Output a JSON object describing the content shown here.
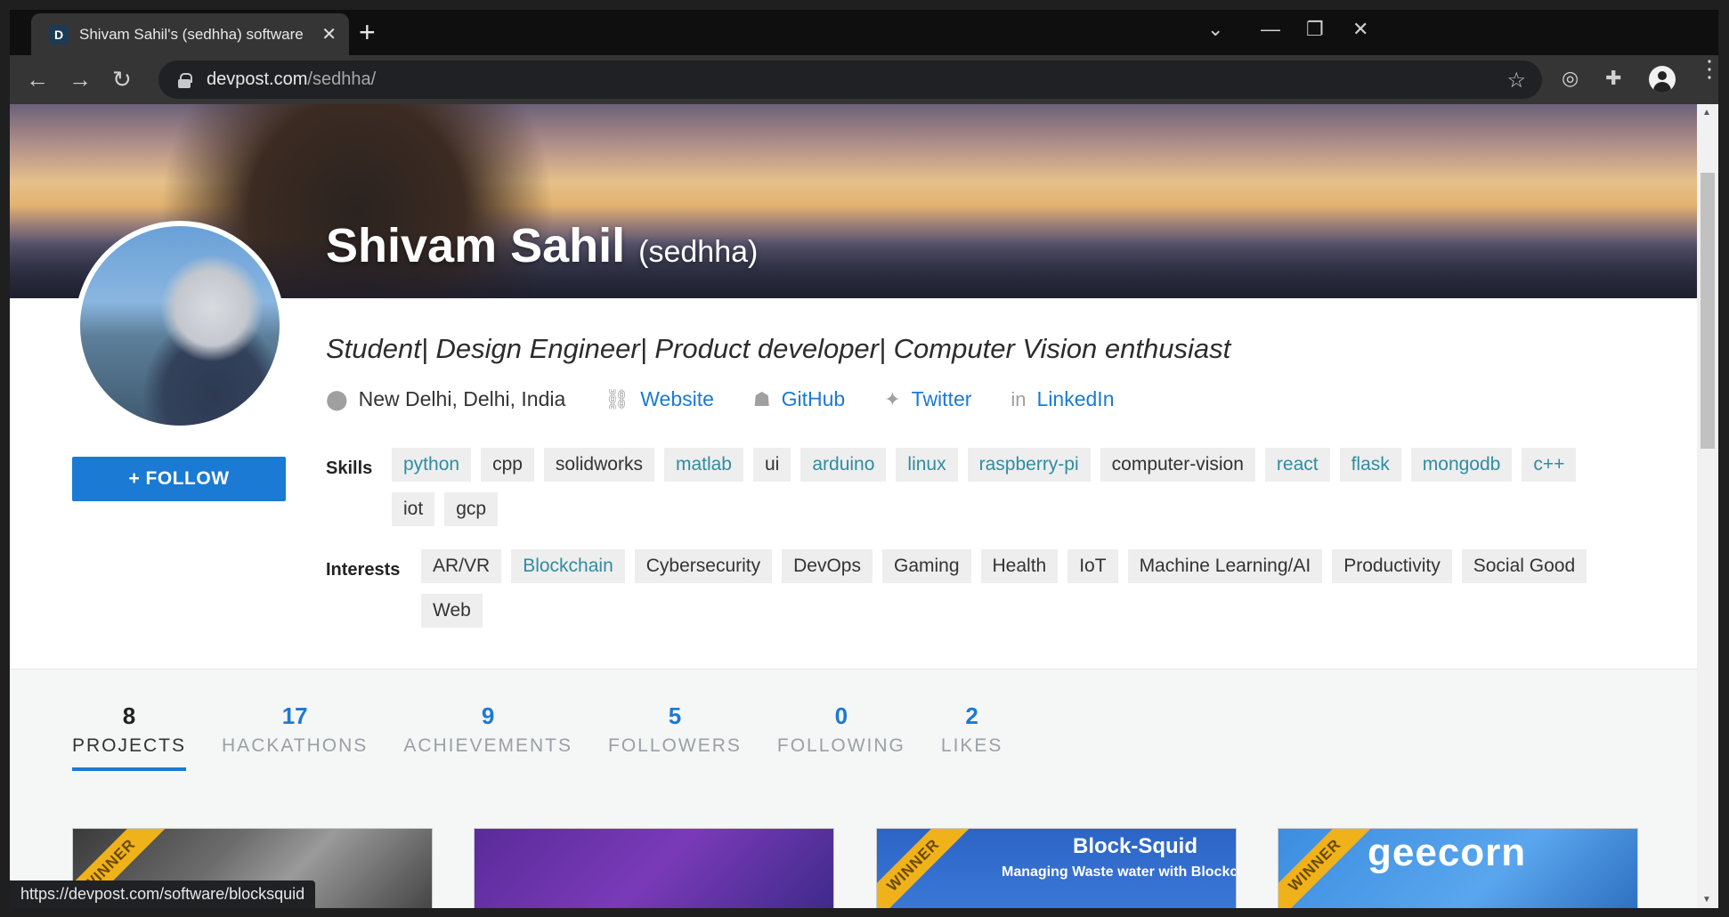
{
  "browser": {
    "tab_title": "Shivam Sahil's (sedhha) software",
    "tab_favicon": "D",
    "url_host": "devpost.com",
    "url_path": "/sedhha/",
    "status_url": "https://devpost.com/software/blocksquid"
  },
  "profile": {
    "name": "Shivam Sahil",
    "handle": "(sedhha)",
    "tagline": "Student| Design Engineer| Product developer| Computer Vision enthusiast",
    "location": "New Delhi, Delhi, India",
    "links": {
      "website": "Website",
      "github": "GitHub",
      "twitter": "Twitter",
      "linkedin": "LinkedIn"
    },
    "follow_label": "+ FOLLOW"
  },
  "skills": {
    "label": "Skills",
    "items": [
      {
        "text": "python",
        "linked": true
      },
      {
        "text": "cpp",
        "linked": false
      },
      {
        "text": "solidworks",
        "linked": false
      },
      {
        "text": "matlab",
        "linked": true
      },
      {
        "text": "ui",
        "linked": false
      },
      {
        "text": "arduino",
        "linked": true
      },
      {
        "text": "linux",
        "linked": true
      },
      {
        "text": "raspberry-pi",
        "linked": true
      },
      {
        "text": "computer-vision",
        "linked": false
      },
      {
        "text": "react",
        "linked": true
      },
      {
        "text": "flask",
        "linked": true
      },
      {
        "text": "mongodb",
        "linked": true
      },
      {
        "text": "c++",
        "linked": true
      },
      {
        "text": "iot",
        "linked": false
      },
      {
        "text": "gcp",
        "linked": false
      }
    ]
  },
  "interests": {
    "label": "Interests",
    "items": [
      {
        "text": "AR/VR",
        "linked": false
      },
      {
        "text": "Blockchain",
        "linked": true
      },
      {
        "text": "Cybersecurity",
        "linked": false
      },
      {
        "text": "DevOps",
        "linked": false
      },
      {
        "text": "Gaming",
        "linked": false
      },
      {
        "text": "Health",
        "linked": false
      },
      {
        "text": "IoT",
        "linked": false
      },
      {
        "text": "Machine Learning/AI",
        "linked": false
      },
      {
        "text": "Productivity",
        "linked": false
      },
      {
        "text": "Social Good",
        "linked": false
      },
      {
        "text": "Web",
        "linked": false
      }
    ]
  },
  "stats": [
    {
      "num": "8",
      "label": "PROJECTS",
      "active": true
    },
    {
      "num": "17",
      "label": "HACKATHONS",
      "active": false
    },
    {
      "num": "9",
      "label": "ACHIEVEMENTS",
      "active": false
    },
    {
      "num": "5",
      "label": "FOLLOWERS",
      "active": false
    },
    {
      "num": "0",
      "label": "FOLLOWING",
      "active": false
    },
    {
      "num": "2",
      "label": "LIKES",
      "active": false
    }
  ],
  "cards": {
    "ribbon": "WINNER",
    "card3_title": "Block-Squid",
    "card3_sub": "Managing Waste water with Blockch",
    "card4_brand": "geecorn"
  },
  "colors": {
    "accent": "#1b7ad3",
    "chip_link": "#2e8da0",
    "ribbon": "#f0b21a"
  }
}
